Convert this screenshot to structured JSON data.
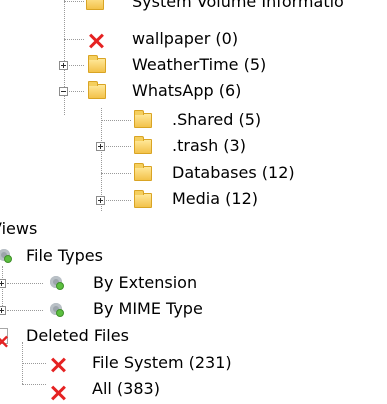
{
  "tree": {
    "clipped_item": {
      "label": "System Volume Informatio"
    },
    "wallpaper": {
      "label": "wallpaper (0)"
    },
    "weathertime": {
      "label": "WeatherTime (5)"
    },
    "whatsapp": {
      "label": "WhatsApp (6)"
    },
    "shared": {
      "label": ".Shared (5)"
    },
    "trash": {
      "label": ".trash (3)"
    },
    "databases": {
      "label": "Databases (12)"
    },
    "media": {
      "label": "Media (12)"
    },
    "views": {
      "label": "Views"
    },
    "file_types": {
      "label": "File Types"
    },
    "by_extension": {
      "label": "By Extension"
    },
    "by_mime": {
      "label": "By MIME Type"
    },
    "deleted_files": {
      "label": "Deleted Files"
    },
    "file_system": {
      "label": "File System (231)"
    },
    "all": {
      "label": "All (383)"
    }
  },
  "icons": {
    "folder": "folder-icon",
    "deleted": "deleted-x-icon",
    "page": "document-icon",
    "gear": "file-types-icon"
  },
  "colors": {
    "folder_fill": "#f3c24a",
    "deleted_red": "#e52222",
    "tree_line": "#9a9a9a"
  }
}
